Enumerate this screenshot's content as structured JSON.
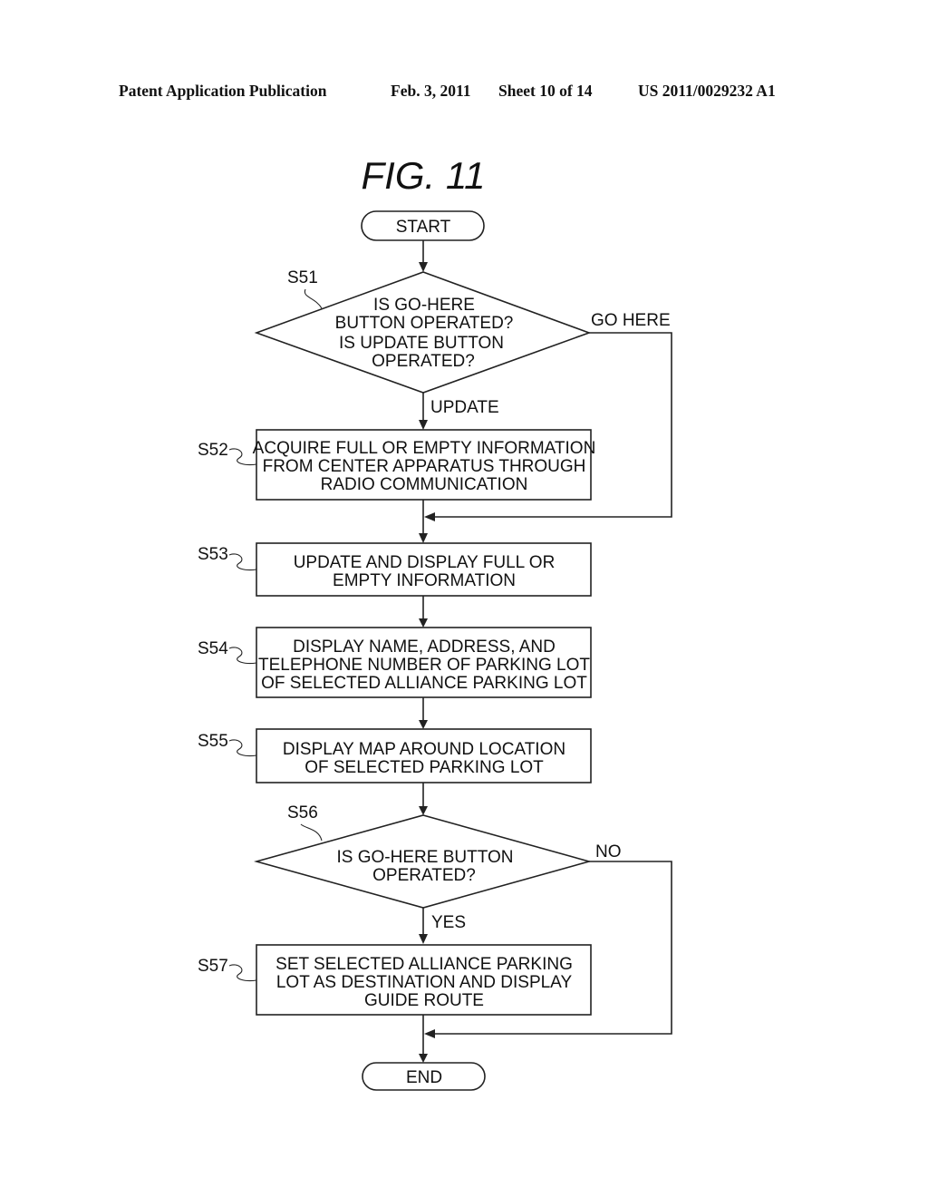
{
  "header": {
    "publication": "Patent Application Publication",
    "date": "Feb. 3, 2011",
    "sheet": "Sheet 10 of 14",
    "number": "US 2011/0029232 A1"
  },
  "figure": {
    "title": "FIG.  11"
  },
  "nodes": {
    "start": {
      "label": "START"
    },
    "s51": {
      "step": "S51",
      "lines": [
        "IS GO-HERE",
        "BUTTON OPERATED?",
        "IS UPDATE BUTTON",
        "OPERATED?"
      ]
    },
    "s52": {
      "step": "S52",
      "lines": [
        "ACQUIRE FULL OR EMPTY INFORMATION",
        "FROM CENTER APPARATUS THROUGH",
        "RADIO COMMUNICATION"
      ]
    },
    "s53": {
      "step": "S53",
      "lines": [
        "UPDATE AND DISPLAY FULL OR",
        "EMPTY INFORMATION"
      ]
    },
    "s54": {
      "step": "S54",
      "lines": [
        "DISPLAY NAME, ADDRESS, AND",
        "TELEPHONE NUMBER OF PARKING LOT",
        "OF SELECTED ALLIANCE PARKING LOT"
      ]
    },
    "s55": {
      "step": "S55",
      "lines": [
        "DISPLAY MAP AROUND LOCATION",
        "OF SELECTED PARKING LOT"
      ]
    },
    "s56": {
      "step": "S56",
      "lines": [
        "IS GO-HERE BUTTON",
        "OPERATED?"
      ]
    },
    "s57": {
      "step": "S57",
      "lines": [
        "SET SELECTED ALLIANCE PARKING",
        "LOT AS DESTINATION AND DISPLAY",
        "GUIDE ROUTE"
      ]
    },
    "end": {
      "label": "END"
    }
  },
  "edges": {
    "s51_update": "UPDATE",
    "s51_go_here": "GO HERE",
    "s56_yes": "YES",
    "s56_no": "NO"
  }
}
